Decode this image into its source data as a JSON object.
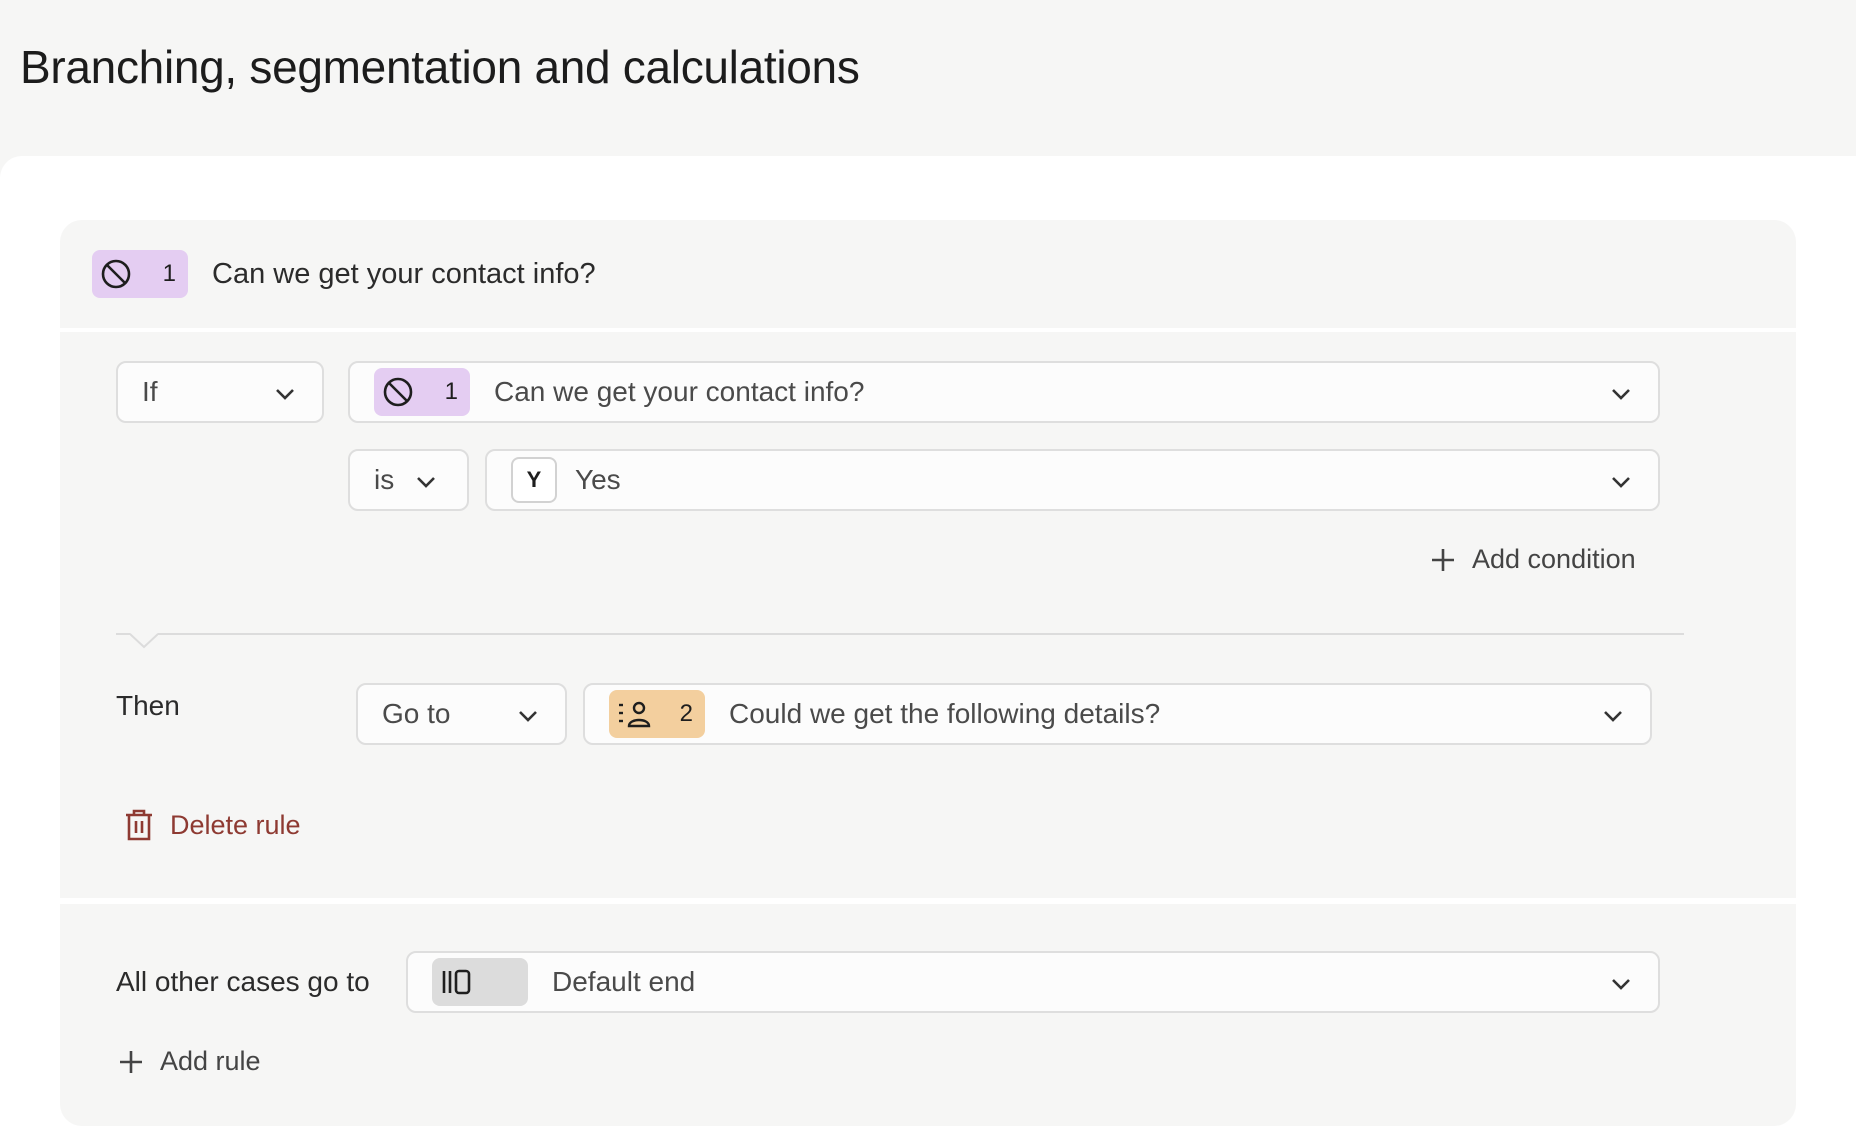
{
  "page": {
    "title": "Branching, segmentation and calculations"
  },
  "question": {
    "number": "1",
    "text": "Can we get your contact info?",
    "icon": "no-symbol-icon",
    "badge_color": "#e4cdf2"
  },
  "rule": {
    "if_select": {
      "value": "If"
    },
    "question_select": {
      "number": "1",
      "text": "Can we get your contact info?",
      "icon": "no-symbol-icon"
    },
    "operator_select": {
      "value": "is"
    },
    "answer_select": {
      "key": "Y",
      "text": "Yes"
    },
    "add_condition_label": "Add condition",
    "then_label": "Then",
    "action_select": {
      "value": "Go to"
    },
    "target_select": {
      "number": "2",
      "text": "Could we get the following details?",
      "icon": "contact-list-icon",
      "badge_color": "#f3cf9e"
    },
    "delete_label": "Delete rule"
  },
  "fallback": {
    "label": "All other cases go to",
    "target": {
      "text": "Default end",
      "icon": "end-screen-icon"
    }
  },
  "add_rule_label": "Add rule",
  "colors": {
    "delete": "#8e3a32",
    "purple_badge": "#e4cdf2",
    "orange_badge": "#f3cf9e"
  }
}
